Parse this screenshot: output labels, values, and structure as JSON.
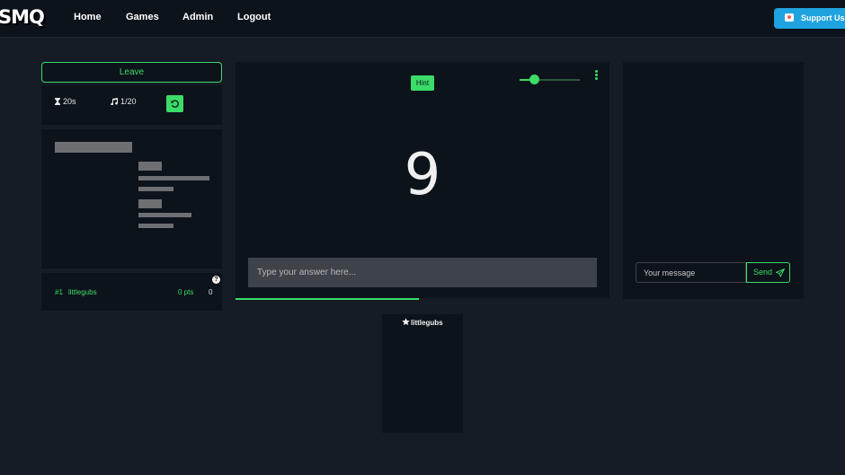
{
  "nav": {
    "logo": "SMQ",
    "links": [
      "Home",
      "Games",
      "Admin",
      "Logout"
    ],
    "support_label": "Support Us!"
  },
  "game": {
    "leave_label": "Leave",
    "timer": "20s",
    "song_progress": "1/20",
    "hint_label": "Hint",
    "countdown": "9",
    "answer_placeholder": "Type your answer here...",
    "volume_level": 0.25,
    "round_progress": 0.49
  },
  "scoreboard": {
    "help": "?",
    "players": [
      {
        "rank": "#1",
        "name": "littlegubs",
        "points": "0 pts",
        "score": "0"
      }
    ]
  },
  "chat": {
    "placeholder": "Your message",
    "send_label": "Send"
  },
  "player_card": {
    "name": "littlegubs"
  },
  "colors": {
    "accent": "#3bdc68",
    "background": "#151c26",
    "panel": "#0d131b",
    "support": "#1fa3e0"
  }
}
